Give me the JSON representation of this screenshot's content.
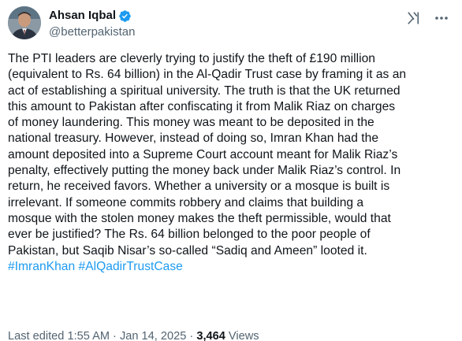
{
  "author": {
    "display_name": "Ahsan Iqbal",
    "handle": "@betterpakistan"
  },
  "tweet": {
    "text": "The PTI leaders are cleverly trying to justify the theft of £190 million\n(equivalent to Rs. 64 billion) in the Al-Qadir Trust case by framing it as an\nact of establishing a spiritual university. The truth is that the UK returned\nthis amount to Pakistan after confiscating it from Malik Riaz on charges\nof money laundering. This money was meant to be deposited in the\nnational treasury. However, instead of doing so, Imran Khan had the\namount deposited into a Supreme Court account meant for Malik Riaz’s\npenalty, effectively putting the money back under Malik Riaz’s control. In\nreturn, he received favors. Whether a university or a mosque is built is\nirrelevant. If someone commits robbery and claims that building a\nmosque with the stolen money makes the theft permissible, would that\never be justified? The Rs. 64 billion belonged to the poor people of\nPakistan, but Saqib Nisar’s so-called “Sadiq and Ameen” looted it.",
    "hashtags": "#ImranKhan #AlQadirTrustCase"
  },
  "meta": {
    "edited_label": "Last edited 1:55 AM · Jan 14, 2025 · ",
    "views_count": "3,464",
    "views_label": " Views"
  },
  "icons": {
    "verified": "verified-badge-icon",
    "grok": "grok-icon",
    "more": "more-options-icon"
  },
  "colors": {
    "link": "#1d9bf0",
    "secondary_text": "#536471",
    "primary_text": "#0f1419",
    "verified_badge": "#1d9bf0"
  }
}
